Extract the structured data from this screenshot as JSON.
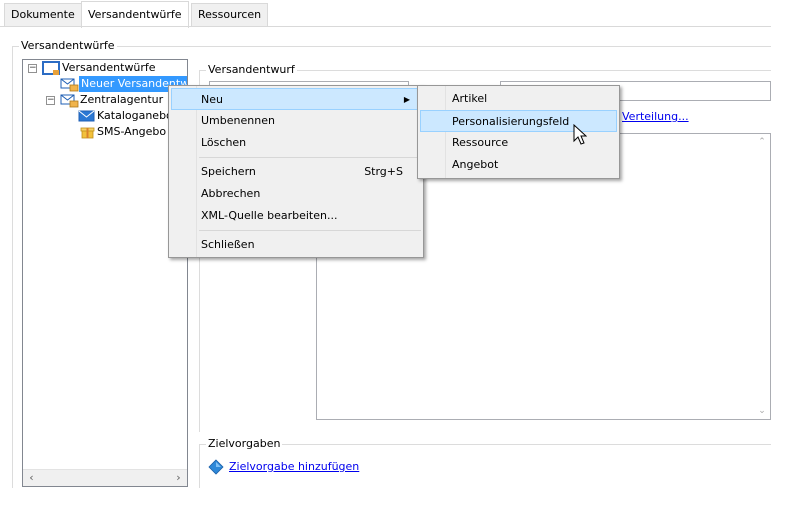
{
  "tabs": [
    {
      "label": "Dokumente",
      "active": false
    },
    {
      "label": "Versandentwürfe",
      "active": true
    },
    {
      "label": "Ressourcen",
      "active": false
    }
  ],
  "outer_group": {
    "legend": "Versandentwürfe"
  },
  "tree": {
    "root_label": "Versandentwürfe",
    "items": [
      {
        "label": "Neuer Versandentwu",
        "selected": true
      },
      {
        "label": "Zentralagentur"
      },
      {
        "label": "Kataloganebo"
      },
      {
        "label": "SMS-Angebo"
      }
    ]
  },
  "detail_group": {
    "legend": "Versandentwurf",
    "link_label": "Verteilung..."
  },
  "targets_group": {
    "legend": "Zielvorgaben",
    "link_label": "Zielvorgabe hinzufügen"
  },
  "context_menu": {
    "items": [
      {
        "label": "Neu",
        "has_submenu": true
      },
      {
        "label": "Umbenennen"
      },
      {
        "label": "Löschen"
      },
      {
        "label": "Speichern",
        "shortcut": "Strg+S"
      },
      {
        "label": "Abbrechen"
      },
      {
        "label": "XML-Quelle bearbeiten..."
      },
      {
        "label": "Schließen"
      }
    ]
  },
  "submenu": {
    "items": [
      {
        "label": "Artikel"
      },
      {
        "label": "Personalisierungsfeld",
        "highlighted": true
      },
      {
        "label": "Ressource"
      },
      {
        "label": "Angebot"
      }
    ]
  },
  "colors": {
    "selection": "#3399ff",
    "menu_highlight": "#cce8ff",
    "link": "#0000ee"
  }
}
